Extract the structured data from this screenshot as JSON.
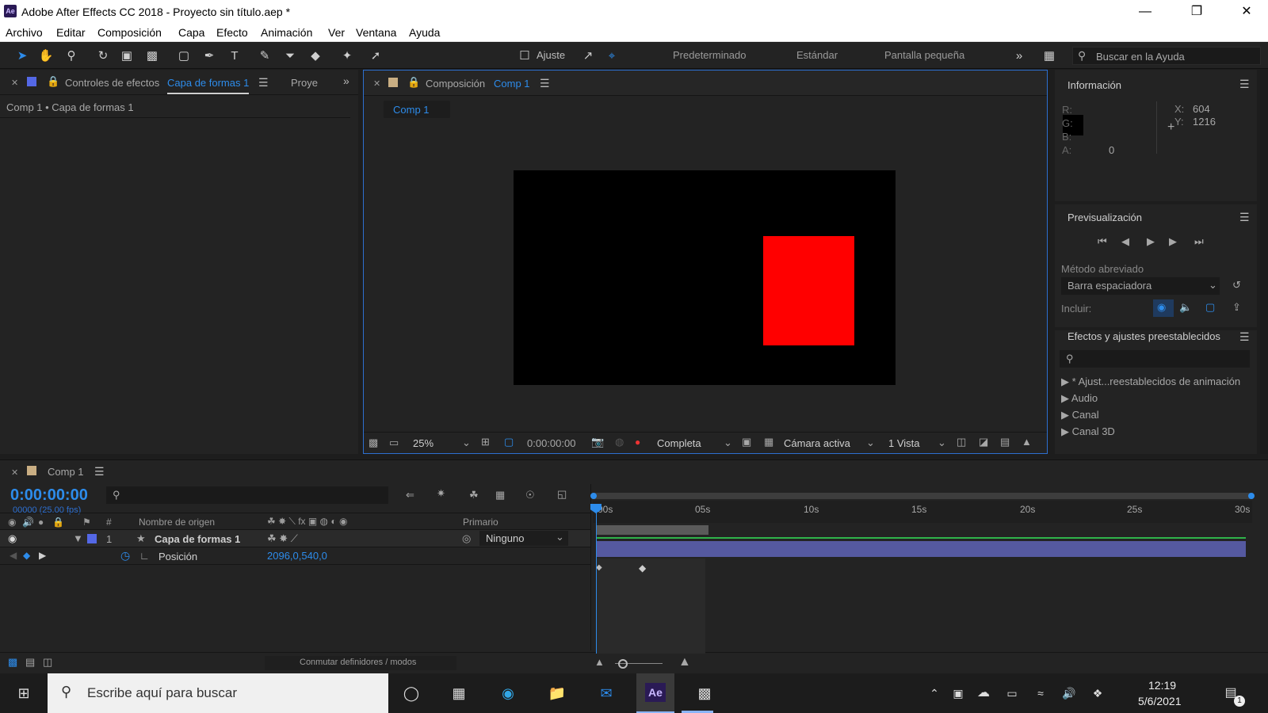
{
  "window": {
    "title": "Adobe After Effects CC 2018 - Proyecto sin título.aep *",
    "app_icon": "Ae"
  },
  "menu": [
    "Archivo",
    "Editar",
    "Composición",
    "Capa",
    "Efecto",
    "Animación",
    "Ver",
    "Ventana",
    "Ayuda"
  ],
  "toolbar": {
    "snap_label": "Ajuste",
    "workspaces": [
      "Predeterminado",
      "Estándar",
      "Pantalla pequeña"
    ],
    "help_placeholder": "Buscar en la Ayuda"
  },
  "effects_panel": {
    "tab_label": "Controles de efectos",
    "tab_layer": "Capa de formas 1",
    "tab_project": "Proye",
    "breadcrumb": "Comp 1 • Capa de formas 1"
  },
  "composition_panel": {
    "tab_label": "Composición",
    "tab_comp": "Comp 1",
    "subtab": "Comp 1",
    "zoom": "25%",
    "timecode": "0:00:00:00",
    "resolution": "Completa",
    "camera": "Cámara activa",
    "views": "1 Vista",
    "red_color": "#ff0000"
  },
  "info_panel": {
    "title": "Información",
    "r_label": "R:",
    "g_label": "G:",
    "b_label": "B:",
    "a_label": "A:",
    "a_value": "0",
    "x_label": "X:",
    "x_value": "604",
    "y_label": "Y:",
    "y_value": "1216"
  },
  "preview_panel": {
    "title": "Previsualización",
    "shortcut_label": "Método abreviado",
    "shortcut_value": "Barra espaciadora",
    "include_label": "Incluir:"
  },
  "effects_presets": {
    "title": "Efectos y ajustes preestablecidos",
    "items": [
      "* Ajust...reestablecidos de animación",
      "Audio",
      "Canal",
      "Canal 3D"
    ]
  },
  "timeline": {
    "comp_name": "Comp 1",
    "timecode": "0:00:00:00",
    "frame_info": "00000 (25.00 fps)",
    "col_num": "#",
    "col_source": "Nombre de origen",
    "col_parent": "Primario",
    "ruler_labels": [
      "00s",
      "05s",
      "10s",
      "15s",
      "20s",
      "25s",
      "30s"
    ],
    "layer": {
      "number": "1",
      "name": "Capa de formas 1",
      "parent": "Ninguno",
      "property": "Posición",
      "property_value": "2096,0,540,0"
    },
    "footer_toggle": "Conmutar definidores / modos"
  },
  "taskbar": {
    "search_placeholder": "Escribe aquí para buscar",
    "time": "12:19",
    "date": "5/6/2021",
    "notif_count": "1",
    "ae_icon": "Ae"
  }
}
